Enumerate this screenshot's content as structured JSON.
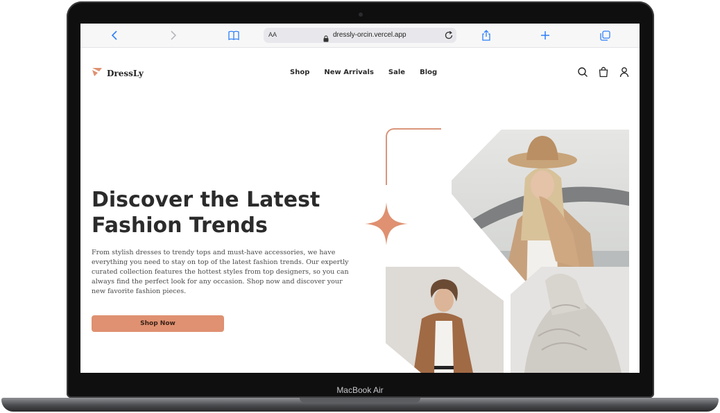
{
  "device": {
    "label": "MacBook Air"
  },
  "browser": {
    "text_size_label": "AA",
    "url": "dressly-orcin.vercel.app"
  },
  "site": {
    "logo_text": "DressLy",
    "nav": [
      "Shop",
      "New Arrivals",
      "Sale",
      "Blog"
    ],
    "hero": {
      "title_line1": "Discover the Latest",
      "title_line2": "Fashion Trends",
      "description": "From stylish dresses to trendy tops and must-have accessories, we have everything you need to stay on top of the latest fashion trends. Our expertly curated collection features the hottest styles from top designers, so you can always find the perfect look for any occasion. Shop now and discover your new favorite fashion pieces.",
      "cta_label": "Shop Now"
    }
  },
  "colors": {
    "accent": "#df9171",
    "heading": "#2b2b2b",
    "safari_blue": "#2d7ff9"
  },
  "icons": [
    "back-icon",
    "forward-icon",
    "bookmarks-icon",
    "lock-icon",
    "reload-icon",
    "share-icon",
    "new-tab-icon",
    "tabs-icon",
    "logo-icon",
    "search-icon",
    "bag-icon",
    "user-icon",
    "sparkle-icon"
  ]
}
